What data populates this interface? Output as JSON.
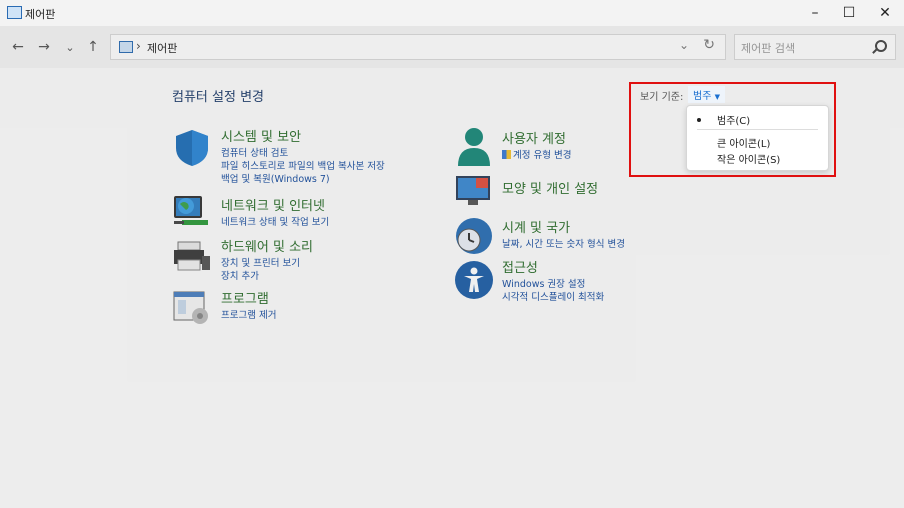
{
  "titlebar": {
    "title": "제어판",
    "minimize": "–",
    "maximize": "☐",
    "close": "✕"
  },
  "nav": {
    "back": "←",
    "forward": "→",
    "recent": "⌄",
    "up": "↑",
    "address": "제어판",
    "sep": "›",
    "dropdown": "⌄",
    "refresh": "↻",
    "search_placeholder": "제어판 검색"
  },
  "main": {
    "heading": "컴퓨터 설정 변경"
  },
  "categories": [
    {
      "title": "시스템 및 보안",
      "links": [
        "컴퓨터 상태 검토",
        "파일 히스토리로 파일의 백업 복사본 저장",
        "백업 및 복원(Windows 7)"
      ]
    },
    {
      "title": "네트워크 및 인터넷",
      "links": [
        "네트워크 상태 및 작업 보기"
      ]
    },
    {
      "title": "하드웨어 및 소리",
      "links": [
        "장치 및 프린터 보기",
        "장치 추가"
      ]
    },
    {
      "title": "프로그램",
      "links": [
        "프로그램 제거"
      ]
    },
    {
      "title": "사용자 계정",
      "links": [
        "계정 유형 변경"
      ]
    },
    {
      "title": "모양 및 개인 설정",
      "links": []
    },
    {
      "title": "시계 및 국가",
      "links": [
        "날짜, 시간 또는 숫자 형식 변경"
      ]
    },
    {
      "title": "접근성",
      "links": [
        "Windows 권장 설정",
        "시각적 디스플레이 최적화"
      ]
    }
  ],
  "viewby": {
    "label": "보기 기준:",
    "value": "범주"
  },
  "menu": {
    "items": [
      "범주(C)",
      "큰 아이콘(L)",
      "작은 아이콘(S)"
    ],
    "selected": "범주(C)"
  },
  "accent": "#e01010"
}
